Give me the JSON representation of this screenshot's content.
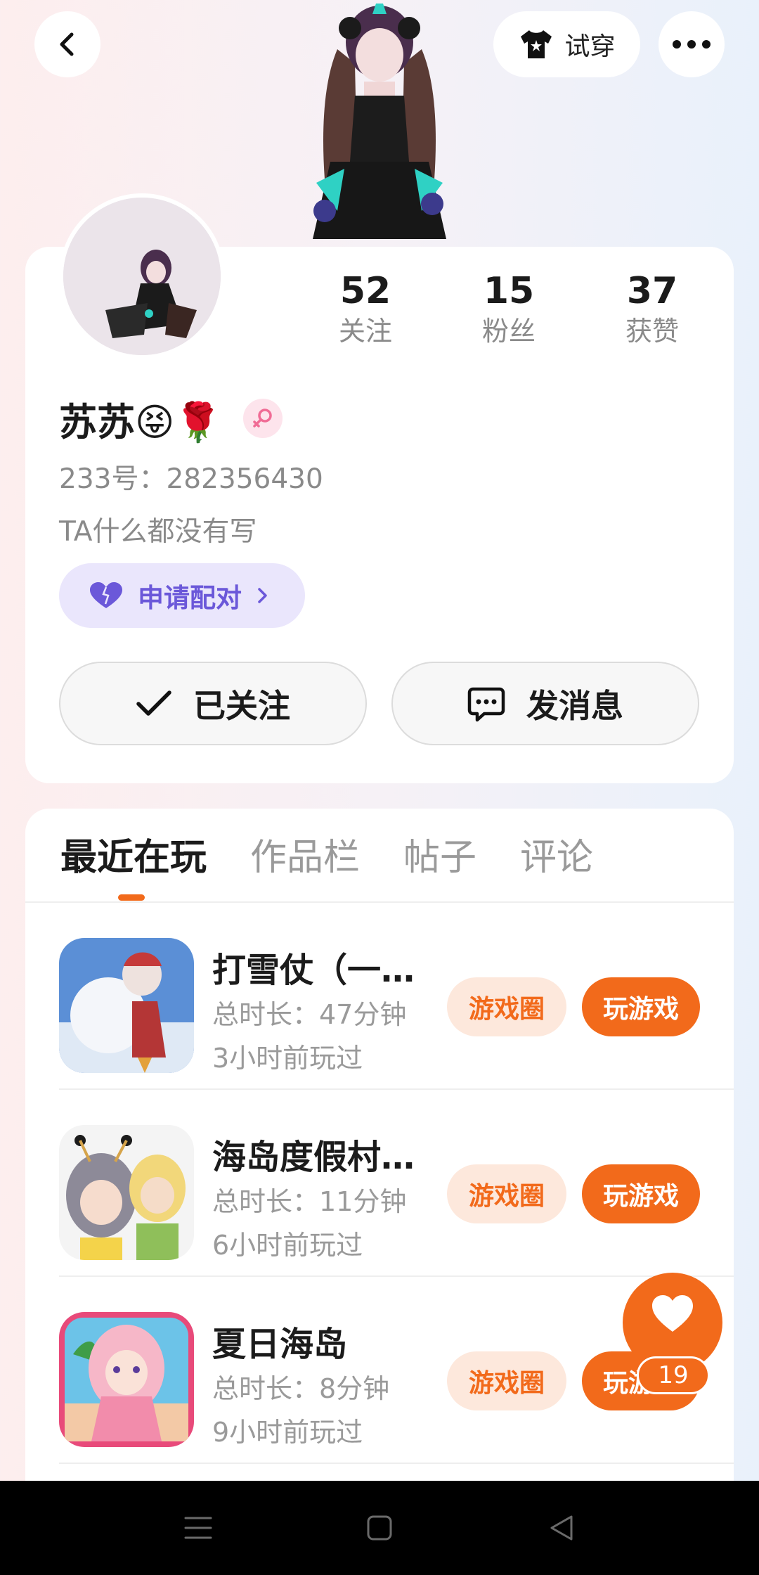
{
  "header": {
    "tryon_label": "试穿"
  },
  "profile": {
    "nickname": "苏苏😝🌹",
    "id_line": "233号：282356430",
    "bio": "TA什么都没有写",
    "pair_label": "申请配对",
    "stats": [
      {
        "value": "52",
        "label": "关注"
      },
      {
        "value": "15",
        "label": "粉丝"
      },
      {
        "value": "37",
        "label": "获赞"
      }
    ],
    "follow_label": "已关注",
    "message_label": "发消息"
  },
  "tabs": [
    {
      "label": "最近在玩",
      "active": true
    },
    {
      "label": "作品栏",
      "active": false
    },
    {
      "label": "帖子",
      "active": false
    },
    {
      "label": "评论",
      "active": false
    }
  ],
  "games": [
    {
      "title": "打雪仗（一…",
      "duration": "总时长：47分钟",
      "last_played": "3小时前玩过",
      "circle_label": "游戏圈",
      "play_label": "玩游戏"
    },
    {
      "title": "海岛度假村…",
      "duration": "总时长：11分钟",
      "last_played": "6小时前玩过",
      "circle_label": "游戏圈",
      "play_label": "玩游戏"
    },
    {
      "title": "夏日海岛",
      "duration": "总时长：8分钟",
      "last_played": "9小时前玩过",
      "circle_label": "游戏圈",
      "play_label": "玩游戏"
    }
  ],
  "like_fab": {
    "count": "19"
  },
  "colors": {
    "accent": "#f26a1b",
    "pair": "#6b58d9"
  }
}
